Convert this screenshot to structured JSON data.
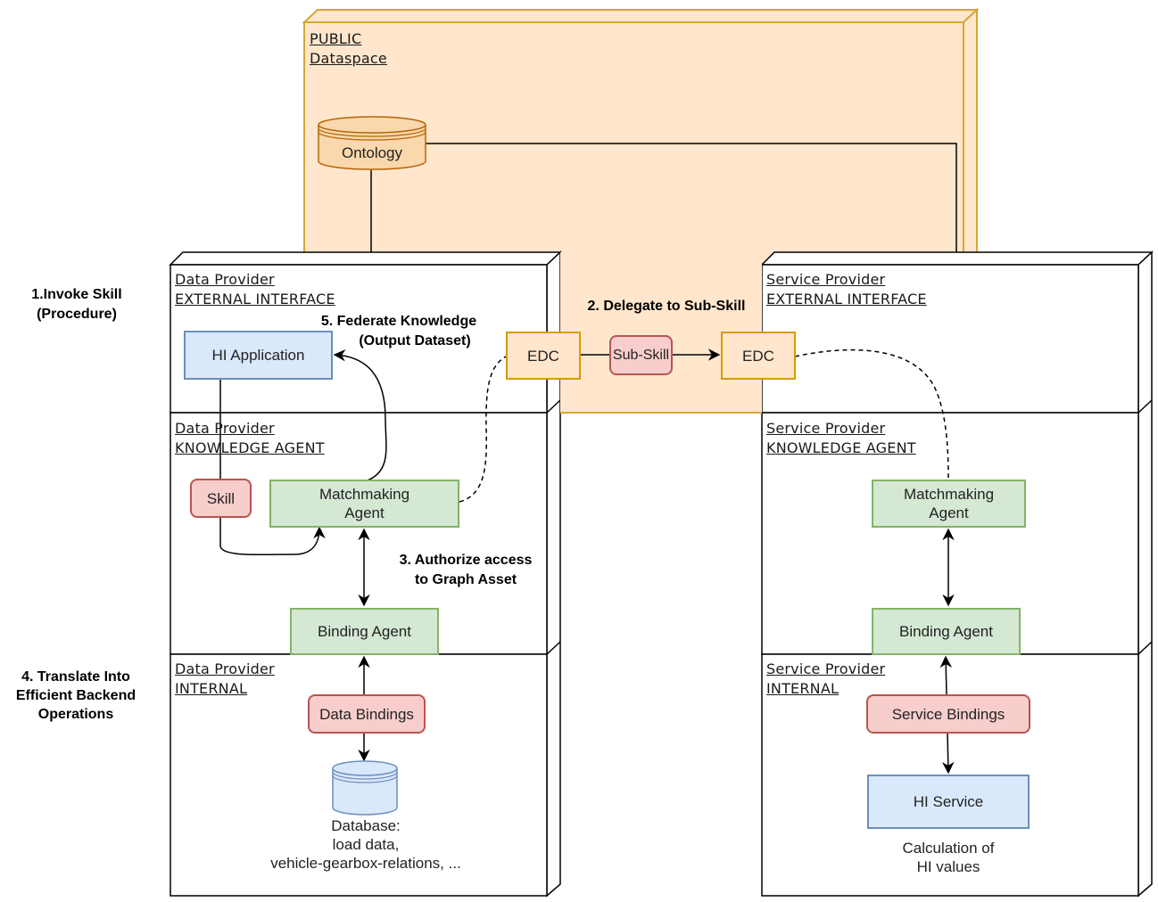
{
  "public_dataspace": {
    "title_line1": "PUBLIC",
    "title_line2": "Dataspace",
    "ontology_label": "Ontology",
    "fill": "#ffe6cc",
    "stroke": "#d6a637"
  },
  "data_provider": {
    "external": {
      "line1": "Data Provider",
      "line2": "EXTERNAL INTERFACE"
    },
    "knowledge": {
      "line1": "Data Provider",
      "line2": "KNOWLEDGE AGENT"
    },
    "internal": {
      "line1": "Data Provider",
      "line2": "INTERNAL"
    },
    "hi_application": "HI Application",
    "skill": "Skill",
    "matchmaking_agent": "Matchmaking Agent",
    "binding_agent": "Binding Agent",
    "data_bindings": "Data Bindings",
    "database_caption": [
      "Database:",
      "load data,",
      "vehicle-gearbox-relations, ..."
    ],
    "edc": "EDC"
  },
  "service_provider": {
    "external": {
      "line1": "Service Provider",
      "line2": "EXTERNAL INTERFACE"
    },
    "knowledge": {
      "line1": "Service Provider",
      "line2": "KNOWLEDGE AGENT"
    },
    "internal": {
      "line1": "Service Provider",
      "line2": "INTERNAL"
    },
    "matchmaking_agent": "Matchmaking Agent",
    "binding_agent": "Binding Agent",
    "service_bindings": "Service Bindings",
    "hi_service": "HI Service",
    "hi_service_caption": [
      "Calculation of",
      "HI values"
    ],
    "edc": "EDC"
  },
  "sub_skill": "Sub-Skill",
  "steps": {
    "step1": [
      "1.Invoke Skill",
      "(Procedure)"
    ],
    "step2": "2. Delegate to Sub-Skill",
    "step3": [
      "3. Authorize access",
      "to Graph Asset"
    ],
    "step4": [
      "4. Translate Into",
      "Efficient Backend",
      "Operations"
    ],
    "step5": [
      "5. Federate Knowledge",
      "(Output Dataset)"
    ]
  },
  "colors": {
    "blue_fill": "#dae8fc",
    "blue_stroke": "#6c8ebf",
    "green_fill": "#d5e8d4",
    "green_stroke": "#82b366",
    "red_fill": "#f8cecc",
    "red_stroke": "#b85450",
    "orange_fill": "#ffe6cc",
    "orange_stroke": "#d79b00"
  }
}
